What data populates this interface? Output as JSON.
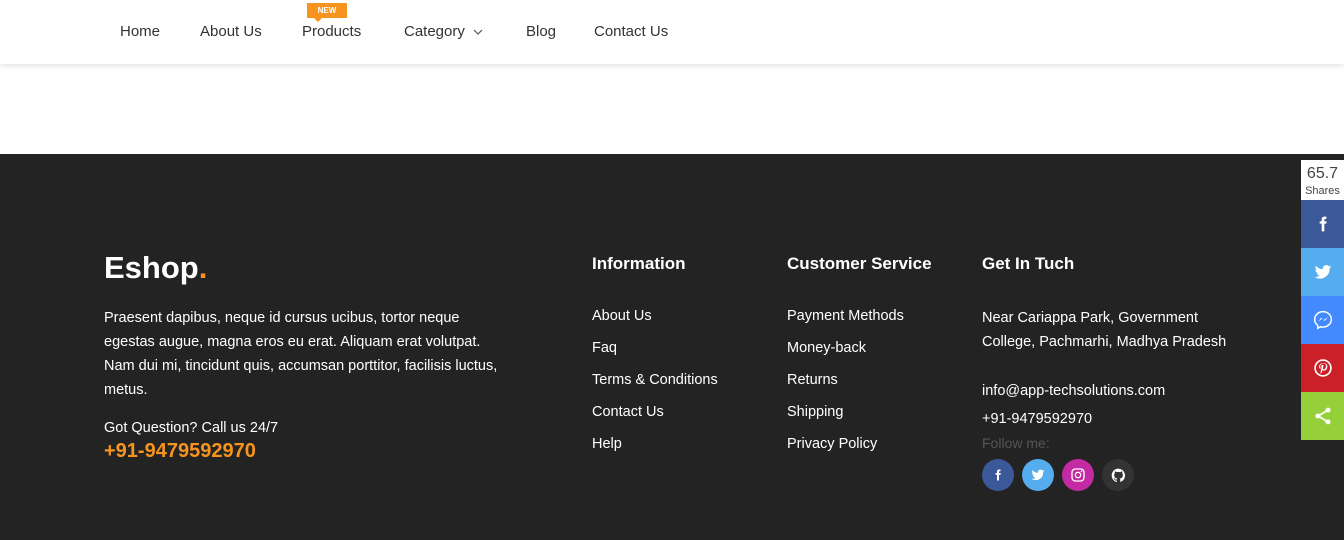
{
  "nav": {
    "home": "Home",
    "about": "About Us",
    "products": "Products",
    "products_badge": "NEW",
    "category": "Category",
    "blog": "Blog",
    "contact": "Contact Us"
  },
  "footer": {
    "brand": "Eshop",
    "brand_dot": ".",
    "about_text": "Praesent dapibus, neque id cursus ucibus, tortor neque egestas augue, magna eros eu erat. Aliquam erat volutpat. Nam dui mi, tincidunt quis, accumsan porttitor, facilisis luctus, metus.",
    "call_text": "Got Question? Call us 24/7",
    "call_phone": "+91-9479592970",
    "information": {
      "title": "Information",
      "items": [
        "About Us",
        "Faq",
        "Terms & Conditions",
        "Contact Us",
        "Help"
      ]
    },
    "customer_service": {
      "title": "Customer Service",
      "items": [
        "Payment Methods",
        "Money-back",
        "Returns",
        "Shipping",
        "Privacy Policy"
      ]
    },
    "get_in_touch": {
      "title": "Get In Tuch",
      "address": "Near Cariappa Park, Government College, Pachmarhi, Madhya Pradesh",
      "email": "info@app-techsolutions.com",
      "phone": "+91-9479592970",
      "follow_label": "Follow me:",
      "social_icons": [
        "facebook-icon",
        "twitter-icon",
        "instagram-icon",
        "github-icon"
      ]
    }
  },
  "share_bar": {
    "count": "65.7",
    "count_label": "Shares",
    "buttons": [
      "facebook-icon",
      "twitter-icon",
      "messenger-icon",
      "pinterest-icon",
      "share-icon"
    ]
  },
  "colors": {
    "accent": "#f7941d",
    "footer_bg": "#232323",
    "facebook": "#3b5998",
    "twitter": "#55acee",
    "messenger": "#448aff",
    "pinterest": "#cb2027",
    "share": "#95d03a",
    "instagram": "#c32aa3",
    "github": "#333333"
  }
}
